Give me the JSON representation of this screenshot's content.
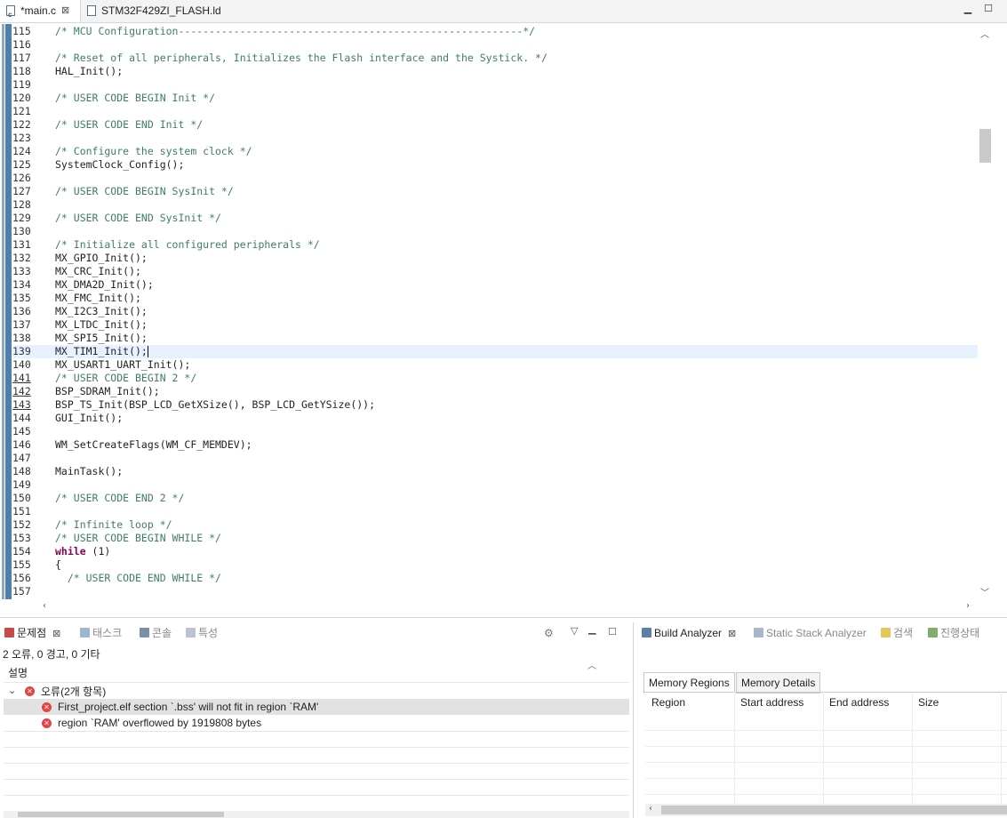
{
  "editor": {
    "tabs": [
      {
        "label": "*main.c",
        "icon": "c-file-icon",
        "active": true
      },
      {
        "label": "STM32F429ZI_FLASH.ld",
        "icon": "ld-file-icon",
        "active": false
      }
    ],
    "current_line": 139,
    "lines": [
      {
        "n": "115",
        "t": "/* MCU Configuration--------------------------------------------------------*/",
        "k": "cm"
      },
      {
        "n": "116",
        "t": "",
        "k": ""
      },
      {
        "n": "117",
        "t": "/* Reset of all peripherals, Initializes the Flash interface and the Systick. */",
        "k": "cm"
      },
      {
        "n": "118",
        "t": "HAL_Init();",
        "k": ""
      },
      {
        "n": "119",
        "t": "",
        "k": ""
      },
      {
        "n": "120",
        "t": "/* USER CODE BEGIN Init */",
        "k": "cm"
      },
      {
        "n": "121",
        "t": "",
        "k": ""
      },
      {
        "n": "122",
        "t": "/* USER CODE END Init */",
        "k": "cm"
      },
      {
        "n": "123",
        "t": "",
        "k": ""
      },
      {
        "n": "124",
        "t": "/* Configure the system clock */",
        "k": "cm"
      },
      {
        "n": "125",
        "t": "SystemClock_Config();",
        "k": ""
      },
      {
        "n": "126",
        "t": "",
        "k": ""
      },
      {
        "n": "127",
        "t": "/* USER CODE BEGIN SysInit */",
        "k": "cm"
      },
      {
        "n": "128",
        "t": "",
        "k": ""
      },
      {
        "n": "129",
        "t": "/* USER CODE END SysInit */",
        "k": "cm"
      },
      {
        "n": "130",
        "t": "",
        "k": ""
      },
      {
        "n": "131",
        "t": "/* Initialize all configured peripherals */",
        "k": "cm"
      },
      {
        "n": "132",
        "t": "MX_GPIO_Init();",
        "k": ""
      },
      {
        "n": "133",
        "t": "MX_CRC_Init();",
        "k": ""
      },
      {
        "n": "134",
        "t": "MX_DMA2D_Init();",
        "k": ""
      },
      {
        "n": "135",
        "t": "MX_FMC_Init();",
        "k": ""
      },
      {
        "n": "136",
        "t": "MX_I2C3_Init();",
        "k": ""
      },
      {
        "n": "137",
        "t": "MX_LTDC_Init();",
        "k": ""
      },
      {
        "n": "138",
        "t": "MX_SPI5_Init();",
        "k": ""
      },
      {
        "n": "139",
        "t": "MX_TIM1_Init();",
        "k": ""
      },
      {
        "n": "140",
        "t": "MX_USART1_UART_Init();",
        "k": ""
      },
      {
        "n": "141",
        "t": "/* USER CODE BEGIN 2 */",
        "k": "cm",
        "u": true
      },
      {
        "n": "142",
        "t": "BSP_SDRAM_Init();",
        "k": "",
        "u": true
      },
      {
        "n": "143",
        "t": "BSP_TS_Init(BSP_LCD_GetXSize(), BSP_LCD_GetYSize());",
        "k": "",
        "u": true
      },
      {
        "n": "144",
        "t": "GUI_Init();",
        "k": ""
      },
      {
        "n": "145",
        "t": "",
        "k": ""
      },
      {
        "n": "146",
        "t": "WM_SetCreateFlags(WM_CF_MEMDEV);",
        "k": ""
      },
      {
        "n": "147",
        "t": "",
        "k": ""
      },
      {
        "n": "148",
        "t": "MainTask();",
        "k": ""
      },
      {
        "n": "149",
        "t": "",
        "k": ""
      },
      {
        "n": "150",
        "t": "/* USER CODE END 2 */",
        "k": "cm"
      },
      {
        "n": "151",
        "t": "",
        "k": ""
      },
      {
        "n": "152",
        "t": "/* Infinite loop */",
        "k": "cm"
      },
      {
        "n": "153",
        "t": "/* USER CODE BEGIN WHILE */",
        "k": "cm"
      },
      {
        "n": "154",
        "t": " (1)",
        "k": "",
        "kw": "while"
      },
      {
        "n": "155",
        "t": "{",
        "k": ""
      },
      {
        "n": "156",
        "t": "  /* USER CODE END WHILE */",
        "k": "cm"
      },
      {
        "n": "157",
        "t": "",
        "k": ""
      }
    ]
  },
  "problems": {
    "tabs": [
      {
        "label": "문제점",
        "active": true
      },
      {
        "label": "태스크",
        "active": false
      },
      {
        "label": "콘솔",
        "active": false
      },
      {
        "label": "특성",
        "active": false
      }
    ],
    "summary": "2 오류, 0 경고, 0 기타",
    "column_header": "설명",
    "group_label": "오류(2개 항목)",
    "errors": [
      "First_project.elf section `.bss' will not fit in region `RAM'",
      "region `RAM' overflowed by 1919808 bytes"
    ]
  },
  "build_analyzer": {
    "tabs": [
      {
        "label": "Build Analyzer",
        "active": true
      },
      {
        "label": "Static Stack Analyzer",
        "active": false
      },
      {
        "label": "검색",
        "active": false
      },
      {
        "label": "진행상태",
        "active": false
      }
    ],
    "subtabs": [
      {
        "label": "Memory Regions",
        "active": true
      },
      {
        "label": "Memory Details",
        "active": false
      }
    ],
    "columns": [
      "Region",
      "Start address",
      "End address",
      "Size"
    ]
  },
  "colors": {
    "comment": "#3f7f5f",
    "keyword": "#7f0055",
    "current_line": "#e8f2fe",
    "error": "#e04444"
  }
}
